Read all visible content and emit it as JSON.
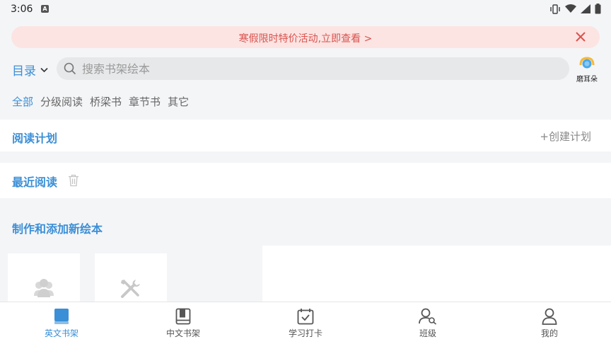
{
  "status": {
    "time": "3:06",
    "notification_badge": "A"
  },
  "promo": {
    "text": "寒假限时特价活动,立即查看 >"
  },
  "header": {
    "catalog_label": "目录",
    "search_placeholder": "搜索书架绘本",
    "ear_label": "磨耳朵"
  },
  "filters": [
    {
      "label": "全部",
      "active": true
    },
    {
      "label": "分级阅读",
      "active": false
    },
    {
      "label": "桥梁书",
      "active": false
    },
    {
      "label": "章节书",
      "active": false
    },
    {
      "label": "其它",
      "active": false
    }
  ],
  "reading_plan": {
    "title": "阅读计划",
    "create_label": "+创建计划"
  },
  "recent": {
    "title": "最近阅读"
  },
  "make_new": {
    "title": "制作和添加新绘本"
  },
  "tabs": [
    {
      "label": "英文书架",
      "icon": "book-filled-icon",
      "active": true
    },
    {
      "label": "中文书架",
      "icon": "book-outline-icon",
      "active": false
    },
    {
      "label": "学习打卡",
      "icon": "calendar-check-icon",
      "active": false
    },
    {
      "label": "班级",
      "icon": "user-search-icon",
      "active": false
    },
    {
      "label": "我的",
      "icon": "profile-icon",
      "active": false
    }
  ],
  "colors": {
    "accent": "#3b8fd6",
    "promo_bg": "#fbe4e2",
    "promo_text": "#d9534f"
  }
}
